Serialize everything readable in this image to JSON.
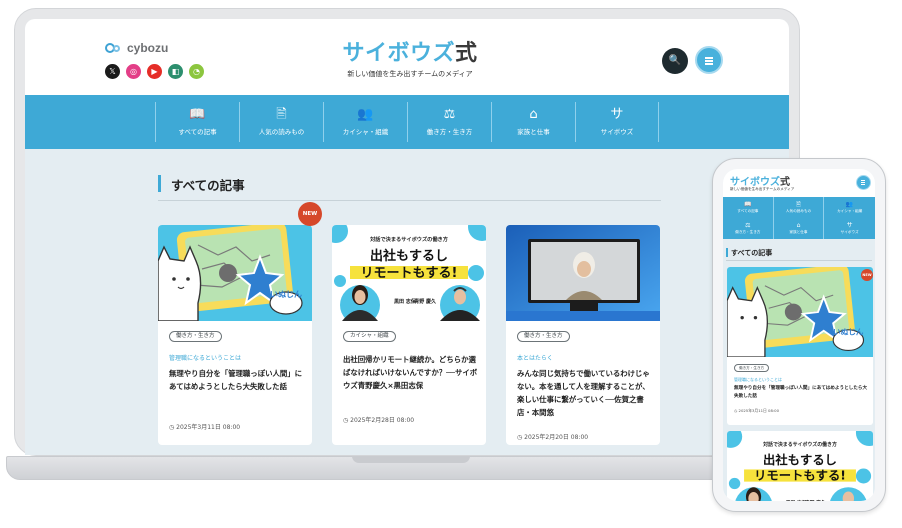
{
  "brand": {
    "name_main": "サイボウズ",
    "name_suffix": "式",
    "tagline": "新しい価値を生み出すチームのメディア"
  },
  "company_logo": {
    "text": "cybozu"
  },
  "social": [
    {
      "name": "x-icon",
      "glyph": "𝕏",
      "color": "#1b1b1b"
    },
    {
      "name": "instagram-icon",
      "glyph": "◎",
      "color": "#e33e87"
    },
    {
      "name": "youtube-icon",
      "glyph": "▶",
      "color": "#e52d27"
    },
    {
      "name": "note-icon",
      "glyph": "◧",
      "color": "#2d8f6e"
    },
    {
      "name": "rss-icon",
      "glyph": "◔",
      "color": "#8cc63f"
    }
  ],
  "header": {
    "search_glyph": "🔍"
  },
  "nav": [
    {
      "label": "すべての記事",
      "icon": "📖"
    },
    {
      "label": "人気の読みもの",
      "icon": "🖹"
    },
    {
      "label": "カイシャ・組織",
      "icon": "👥"
    },
    {
      "label": "働き方・生き方",
      "icon": "⚖"
    },
    {
      "label": "家族と仕事",
      "icon": "⌂"
    },
    {
      "label": "サイボウズ",
      "icon": "サ"
    }
  ],
  "section": {
    "title": "すべての記事"
  },
  "articles": [
    {
      "badge": "働き方・生き方",
      "category": "管理職になるということは",
      "title": "無理やり自分を「管理職っぽい人間」にあてはめようとしたら大失敗した話",
      "date": "2025年3月11日 08:00",
      "is_new": true,
      "new_label": "NEW",
      "image_caption": "いぬじん"
    },
    {
      "badge": "カイシャ・組織",
      "category": "",
      "title": "出社回帰かリモート継続か。どちらか選ばなければいけないんですか？──サイボウズ青野慶久×黒田志保",
      "date": "2025年2月28日 08:00",
      "is_new": false,
      "image_kicker": "対話で決まるサイボウズの働き方",
      "image_headline_1": "出社もするし",
      "image_headline_2": "リモートもする!",
      "person_1": "黒田 志保",
      "person_2": "青野 慶久"
    },
    {
      "badge": "働き方・生き方",
      "category": "本とはたらく",
      "title": "みんな同じ気持ちで働いているわけじゃない。本を通して人を理解することが、楽しい仕事に繋がっていく──佐賀之書店・本間悠",
      "date": "2025年2月20日 08:00",
      "is_new": false
    }
  ],
  "phone": {
    "section_title": "すべての記事",
    "nav": [
      {
        "label": "すべての記事",
        "icon": "📖"
      },
      {
        "label": "人気の読みもの",
        "icon": "🖹"
      },
      {
        "label": "カイシャ・組織",
        "icon": "👥"
      },
      {
        "label": "働き方・生き方",
        "icon": "⚖"
      },
      {
        "label": "家族と仕事",
        "icon": "⌂"
      },
      {
        "label": "サイボウズ",
        "icon": "サ"
      }
    ]
  }
}
